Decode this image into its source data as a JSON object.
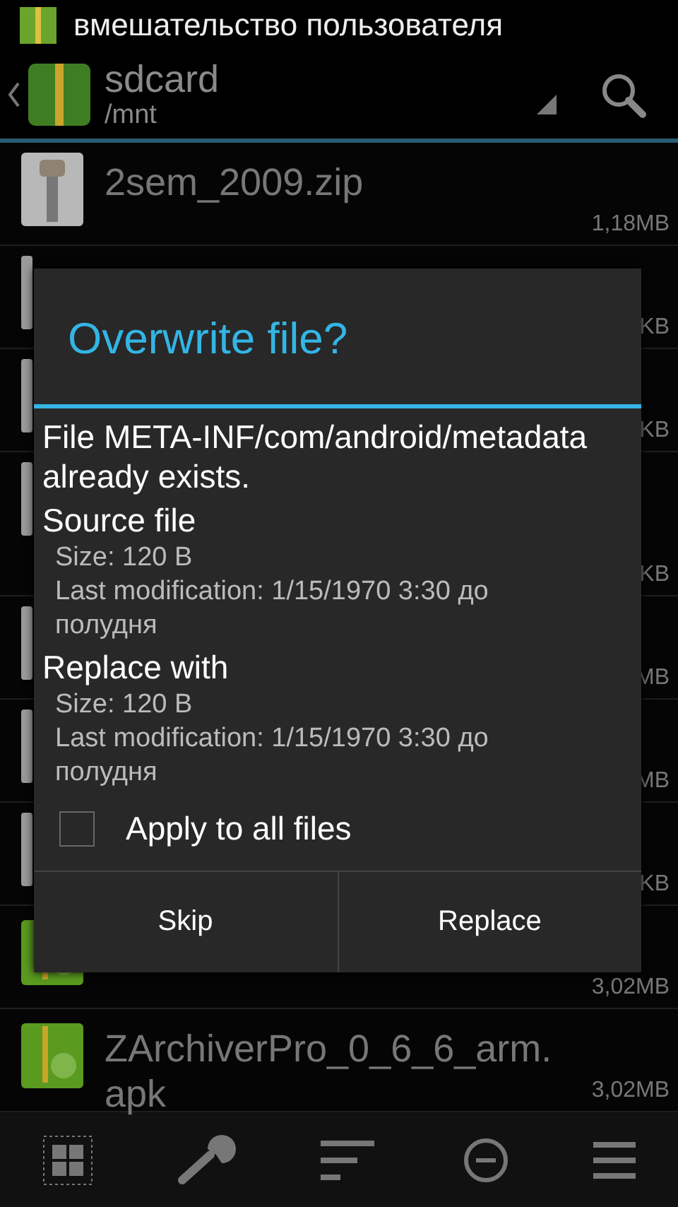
{
  "status_bar": {
    "title": "вмешательство пользователя"
  },
  "action_bar": {
    "title": "sdcard",
    "path": "/mnt"
  },
  "files": [
    {
      "kind": "zip",
      "name": "2sem_2009.zip",
      "size": "1,18MB"
    },
    {
      "kind": "file",
      "size": "KB"
    },
    {
      "kind": "file",
      "size": "KB"
    },
    {
      "kind": "file",
      "tall": true,
      "size": "KB"
    },
    {
      "kind": "file",
      "size": "MB"
    },
    {
      "kind": "file",
      "size": "MB"
    },
    {
      "kind": "file",
      "size": "KB"
    },
    {
      "kind": "apk",
      "size": "3,02MB"
    },
    {
      "kind": "apk",
      "name": "ZArchiverPro_0_6_6_arm.apk",
      "size": "3,02MB"
    }
  ],
  "dialog": {
    "title": "Overwrite file?",
    "message": "File META-INF/com/android/metadata already exists.",
    "sections": [
      {
        "heading": "Source file",
        "size": "Size: 120 B",
        "modified": "Last modification: 1/15/1970 3:30 до полудня"
      },
      {
        "heading": "Replace with",
        "size": "Size: 120 B",
        "modified": "Last modification: 1/15/1970 3:30 до полудня"
      }
    ],
    "apply_all": {
      "label": "Apply to all files",
      "checked": false
    },
    "buttons": [
      "Skip",
      "Replace"
    ]
  }
}
